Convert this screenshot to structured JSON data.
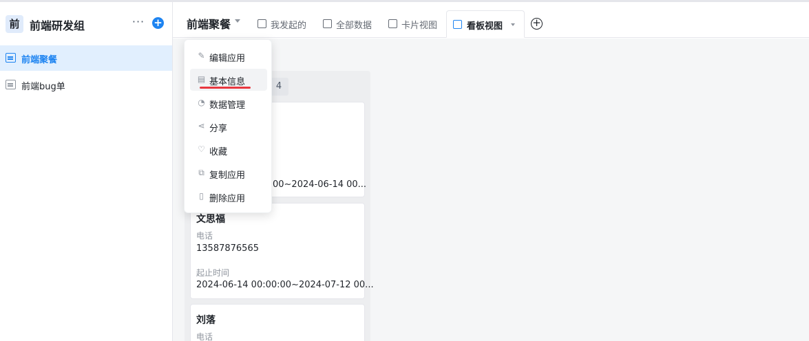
{
  "workspace": {
    "avatar_char": "前",
    "name": "前端研发组",
    "more": "···",
    "add": "+"
  },
  "sidebar": {
    "items": [
      {
        "label": "前端聚餐",
        "active": true
      },
      {
        "label": "前端bug单",
        "active": false
      }
    ]
  },
  "header": {
    "app_title": "前端聚餐",
    "tabs": [
      {
        "label": "我发起的",
        "icon": "edit-doc-icon"
      },
      {
        "label": "全部数据",
        "icon": "table-grid-icon"
      },
      {
        "label": "卡片视图",
        "icon": "card-image-icon"
      },
      {
        "label": "看板视图",
        "icon": "kanban-icon",
        "active": true
      }
    ],
    "add_tab": "+"
  },
  "board": {
    "column_count": "4",
    "cards": [
      {
        "date_value": "00~2024-06-14 00..."
      },
      {
        "title": "文思福",
        "phone_label": "电话",
        "phone": "13587876565",
        "time_label": "起止时间",
        "time": "2024-06-14 00:00:00~2024-07-12 00..."
      },
      {
        "title": "刘落",
        "phone_label": "电话"
      }
    ]
  },
  "menu": {
    "items": [
      {
        "label": "编辑应用",
        "icon": "edit-icon"
      },
      {
        "label": "基本信息",
        "icon": "info-doc-icon",
        "hover": true
      },
      {
        "label": "数据管理",
        "icon": "dashboard-icon"
      },
      {
        "label": "分享",
        "icon": "share-icon"
      },
      {
        "label": "收藏",
        "icon": "heart-icon"
      },
      {
        "label": "复制应用",
        "icon": "copy-icon"
      },
      {
        "label": "删除应用",
        "icon": "trash-icon"
      }
    ]
  },
  "colors": {
    "accent": "#1e84f1",
    "active_bg": "#e1effe",
    "annotation": "#e8373f"
  }
}
